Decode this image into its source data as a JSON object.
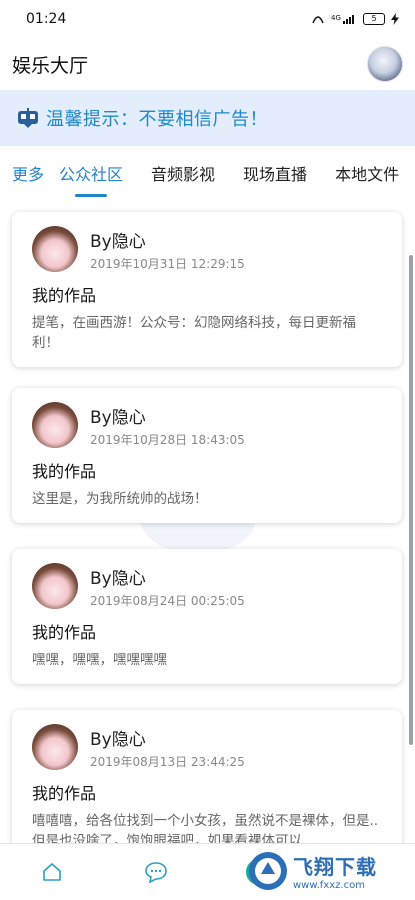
{
  "statusbar": {
    "time": "01:24",
    "network": "4G",
    "battery": "5"
  },
  "appbar": {
    "title": "娱乐大厅"
  },
  "notice": {
    "text": "温馨提示：不要相信广告！"
  },
  "tabs": [
    {
      "label": "更多"
    },
    {
      "label": "公众社区"
    },
    {
      "label": "音频影视"
    },
    {
      "label": "现场直播"
    },
    {
      "label": "本地文件"
    }
  ],
  "posts": [
    {
      "author": "By隐心",
      "date": "2019年10月31日 12:29:15",
      "title": "我的作品",
      "body": "提笔，在画西游！公众号：幻隐网络科技，每日更新福利！"
    },
    {
      "author": "By隐心",
      "date": "2019年10月28日 18:43:05",
      "title": "我的作品",
      "body": "这里是，为我所统帅的战场！"
    },
    {
      "author": "By隐心",
      "date": "2019年08月24日 00:25:05",
      "title": "我的作品",
      "body": "嘿嘿，嘿嘿，嘿嘿嘿嘿"
    },
    {
      "author": "By隐心",
      "date": "2019年08月13日 23:44:25",
      "title": "我的作品",
      "body": "嘻嘻嘻，给各位找到一个小女孩，虽然说不是裸体，但是..但是也没啥了，饱饱眼福吧，如果看裸体可以"
    }
  ],
  "watermark": {
    "title": "飞翔下载",
    "url": "www.fxxz.com"
  },
  "colors": {
    "accent": "#2283c9",
    "notice_bg": "#e3edfb"
  },
  "icons": {
    "home": "home-icon",
    "chat": "chat-icon",
    "fingerprint": "fingerprint-icon",
    "notice": "robot-icon"
  }
}
